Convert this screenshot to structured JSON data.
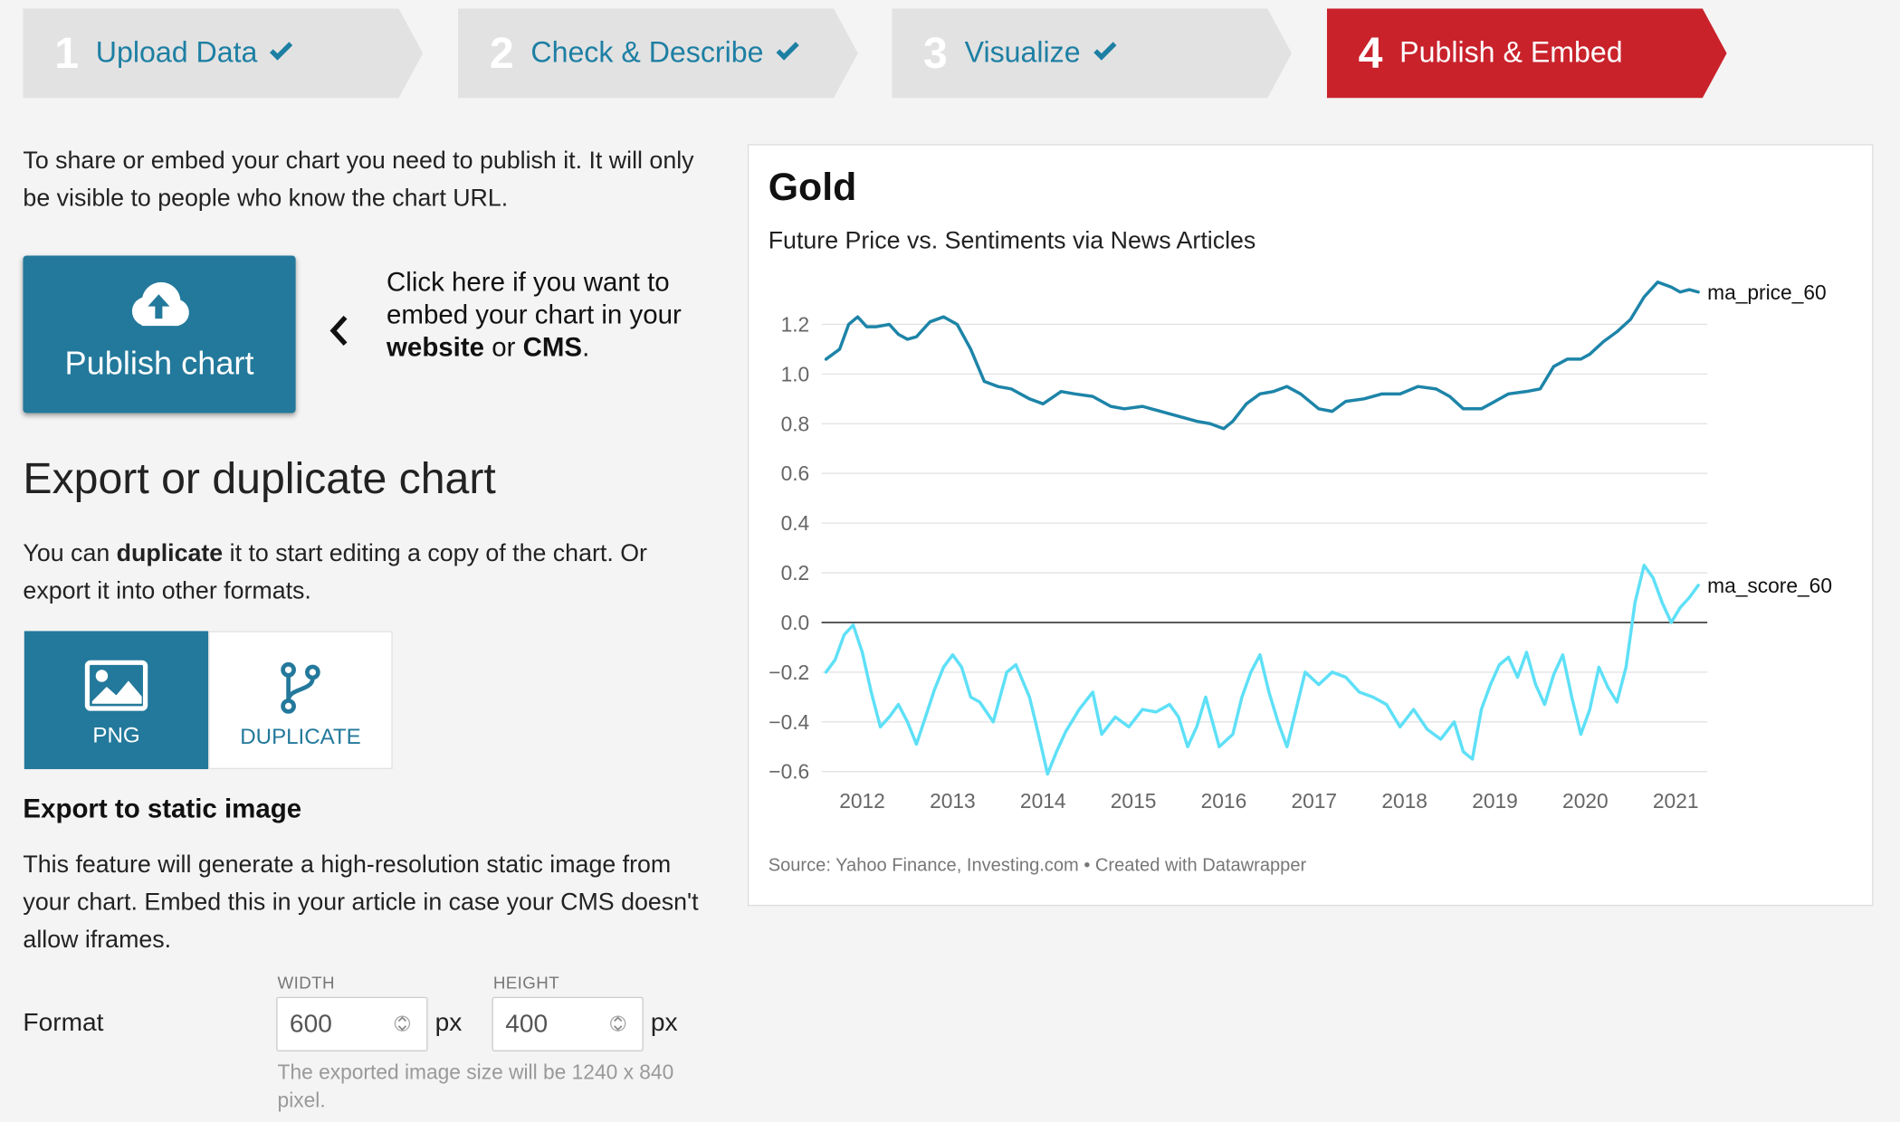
{
  "steps": [
    {
      "num": "1",
      "label": "Upload Data",
      "done": true
    },
    {
      "num": "2",
      "label": "Check & Describe",
      "done": true
    },
    {
      "num": "3",
      "label": "Visualize",
      "done": true
    },
    {
      "num": "4",
      "label": "Publish & Embed",
      "done": false
    }
  ],
  "intro": "To share or embed your chart you need to publish it. It will only be visible to people who know the chart URL.",
  "publish": {
    "button_label": "Publish chart",
    "hint_pre": "Click here if you want to embed your chart in your ",
    "hint_bold1": "website",
    "hint_mid": " or ",
    "hint_bold2": "CMS",
    "hint_end": "."
  },
  "export": {
    "title": "Export or duplicate chart",
    "desc_pre": "You can ",
    "desc_bold": "duplicate",
    "desc_post": " it to start editing a copy of the chart. Or export it into other formats.",
    "png_label": "PNG",
    "duplicate_label": "DUPLICATE",
    "static_title": "Export to static image",
    "static_desc": "This feature will generate a high-resolution static image from your chart. Embed this in your article in case your CMS doesn't allow iframes.",
    "width_label": "WIDTH",
    "height_label": "HEIGHT",
    "format_label": "Format",
    "width_value": "600",
    "height_value": "400",
    "unit": "px",
    "helper": "The exported image size will be 1240 x 840 pixel."
  },
  "chart": {
    "title": "Gold",
    "subtitle": "Future Price vs. Sentiments via News Articles",
    "source": "Source: Yahoo Finance, Investing.com • Created with Datawrapper"
  },
  "chart_data": {
    "type": "line",
    "title": "Gold",
    "subtitle": "Future Price vs. Sentiments via News Articles",
    "xlabel": "",
    "ylabel": "",
    "x_ticks": [
      2012,
      2013,
      2014,
      2015,
      2016,
      2017,
      2018,
      2019,
      2020,
      2021
    ],
    "xlim": [
      2011.55,
      2021.35
    ],
    "y_ticks": [
      -0.6,
      -0.4,
      -0.2,
      0.0,
      0.2,
      0.4,
      0.6,
      0.8,
      1.0,
      1.2
    ],
    "ylim": [
      -0.6,
      1.35
    ],
    "grid": true,
    "legend": "direct labels at line ends",
    "series": [
      {
        "name": "ma_price_60",
        "color": "#1d84a8",
        "x": [
          2011.6,
          2011.75,
          2011.85,
          2011.95,
          2012.05,
          2012.15,
          2012.3,
          2012.4,
          2012.5,
          2012.6,
          2012.75,
          2012.9,
          2013.05,
          2013.2,
          2013.35,
          2013.5,
          2013.65,
          2013.85,
          2014.0,
          2014.2,
          2014.35,
          2014.55,
          2014.75,
          2014.9,
          2015.1,
          2015.3,
          2015.5,
          2015.7,
          2015.85,
          2016.0,
          2016.1,
          2016.25,
          2016.4,
          2016.55,
          2016.7,
          2016.85,
          2017.05,
          2017.2,
          2017.35,
          2017.55,
          2017.75,
          2017.95,
          2018.15,
          2018.35,
          2018.5,
          2018.65,
          2018.85,
          2019.0,
          2019.15,
          2019.35,
          2019.5,
          2019.65,
          2019.8,
          2019.95,
          2020.05,
          2020.2,
          2020.35,
          2020.5,
          2020.65,
          2020.8,
          2020.95,
          2021.05,
          2021.15,
          2021.25
        ],
        "y": [
          1.06,
          1.1,
          1.2,
          1.23,
          1.19,
          1.19,
          1.2,
          1.16,
          1.14,
          1.15,
          1.21,
          1.23,
          1.2,
          1.1,
          0.97,
          0.95,
          0.94,
          0.9,
          0.88,
          0.93,
          0.92,
          0.91,
          0.87,
          0.86,
          0.87,
          0.85,
          0.83,
          0.81,
          0.8,
          0.78,
          0.81,
          0.88,
          0.92,
          0.93,
          0.95,
          0.92,
          0.86,
          0.85,
          0.89,
          0.9,
          0.92,
          0.92,
          0.95,
          0.94,
          0.91,
          0.86,
          0.86,
          0.89,
          0.92,
          0.93,
          0.94,
          1.03,
          1.06,
          1.06,
          1.08,
          1.13,
          1.17,
          1.22,
          1.31,
          1.37,
          1.35,
          1.33,
          1.34,
          1.33
        ]
      },
      {
        "name": "ma_score_60",
        "color": "#5ee0f7",
        "x": [
          2011.6,
          2011.7,
          2011.8,
          2011.9,
          2012.0,
          2012.1,
          2012.2,
          2012.3,
          2012.4,
          2012.5,
          2012.6,
          2012.7,
          2012.8,
          2012.9,
          2013.0,
          2013.1,
          2013.2,
          2013.3,
          2013.45,
          2013.6,
          2013.7,
          2013.85,
          2013.95,
          2014.05,
          2014.15,
          2014.25,
          2014.4,
          2014.55,
          2014.65,
          2014.8,
          2014.95,
          2015.1,
          2015.25,
          2015.4,
          2015.5,
          2015.6,
          2015.7,
          2015.8,
          2015.95,
          2016.1,
          2016.2,
          2016.3,
          2016.4,
          2016.5,
          2016.6,
          2016.7,
          2016.8,
          2016.9,
          2017.05,
          2017.2,
          2017.35,
          2017.5,
          2017.65,
          2017.8,
          2017.95,
          2018.1,
          2018.25,
          2018.4,
          2018.55,
          2018.65,
          2018.75,
          2018.85,
          2018.95,
          2019.05,
          2019.15,
          2019.25,
          2019.35,
          2019.45,
          2019.55,
          2019.65,
          2019.75,
          2019.85,
          2019.95,
          2020.05,
          2020.15,
          2020.25,
          2020.35,
          2020.45,
          2020.55,
          2020.65,
          2020.75,
          2020.85,
          2020.95,
          2021.05,
          2021.15,
          2021.25
        ],
        "y": [
          -0.2,
          -0.15,
          -0.05,
          -0.01,
          -0.12,
          -0.28,
          -0.42,
          -0.38,
          -0.33,
          -0.4,
          -0.49,
          -0.38,
          -0.27,
          -0.18,
          -0.13,
          -0.18,
          -0.3,
          -0.32,
          -0.4,
          -0.2,
          -0.17,
          -0.3,
          -0.45,
          -0.61,
          -0.52,
          -0.44,
          -0.35,
          -0.28,
          -0.45,
          -0.38,
          -0.42,
          -0.35,
          -0.36,
          -0.33,
          -0.38,
          -0.5,
          -0.42,
          -0.3,
          -0.5,
          -0.45,
          -0.3,
          -0.2,
          -0.13,
          -0.28,
          -0.4,
          -0.5,
          -0.35,
          -0.2,
          -0.25,
          -0.2,
          -0.22,
          -0.28,
          -0.3,
          -0.33,
          -0.42,
          -0.35,
          -0.43,
          -0.47,
          -0.4,
          -0.52,
          -0.55,
          -0.35,
          -0.25,
          -0.17,
          -0.14,
          -0.22,
          -0.12,
          -0.25,
          -0.33,
          -0.21,
          -0.13,
          -0.3,
          -0.45,
          -0.35,
          -0.18,
          -0.26,
          -0.32,
          -0.18,
          0.08,
          0.23,
          0.18,
          0.08,
          0.0,
          0.06,
          0.1,
          0.15
        ]
      }
    ]
  }
}
